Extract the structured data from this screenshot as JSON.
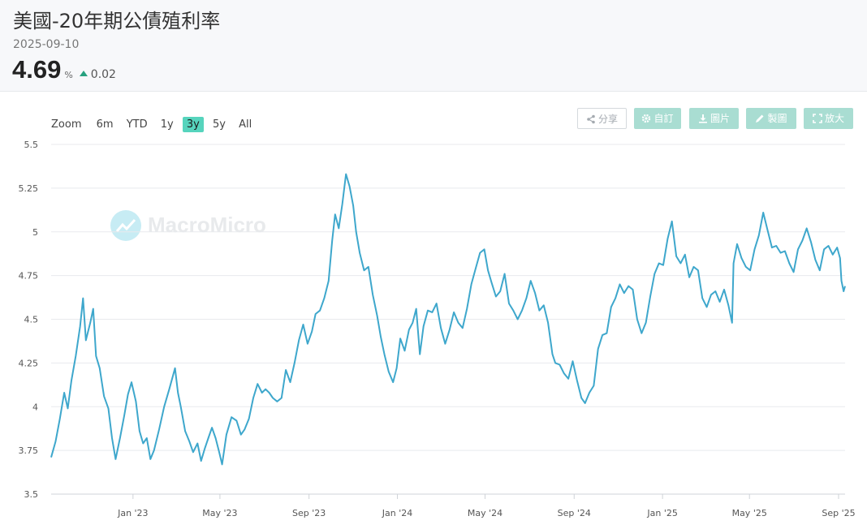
{
  "header": {
    "title": "美國-20年期公債殖利率",
    "date": "2025-09-10",
    "value": "4.69",
    "unit": "%",
    "change": "0.02"
  },
  "zoom": {
    "label": "Zoom",
    "options": [
      "6m",
      "YTD",
      "1y",
      "3y",
      "5y",
      "All"
    ],
    "active": "3y"
  },
  "toolbar": {
    "share": "分享",
    "customize": "自訂",
    "image": "圖片",
    "draw": "製圖",
    "fullscreen": "放大"
  },
  "watermark": "MacroMicro",
  "colors": {
    "line": "#3ea7cc",
    "accent": "#56d4bd",
    "up": "#27a17f"
  },
  "chart_data": {
    "type": "line",
    "title": "",
    "xlabel": "",
    "ylabel": "",
    "x_range": [
      "2022-09-10",
      "2025-09-10"
    ],
    "ylim": [
      3.5,
      5.5
    ],
    "y_ticks": [
      "3.5",
      "3.75",
      "4",
      "4.25",
      "4.5",
      "4.75",
      "5",
      "5.25",
      "5.5"
    ],
    "x_ticks": [
      {
        "date": "2023-01-01",
        "label": "Jan '23"
      },
      {
        "date": "2023-05-01",
        "label": "May '23"
      },
      {
        "date": "2023-09-01",
        "label": "Sep '23"
      },
      {
        "date": "2024-01-01",
        "label": "Jan '24"
      },
      {
        "date": "2024-05-01",
        "label": "May '24"
      },
      {
        "date": "2024-09-01",
        "label": "Sep '24"
      },
      {
        "date": "2025-01-01",
        "label": "Jan '25"
      },
      {
        "date": "2025-05-01",
        "label": "May '25"
      },
      {
        "date": "2025-09-01",
        "label": "Sep '25"
      }
    ],
    "grid": true,
    "legend": "none",
    "series": [
      {
        "points": [
          [
            "2022-09-10",
            3.71
          ],
          [
            "2022-09-16",
            3.8
          ],
          [
            "2022-09-22",
            3.93
          ],
          [
            "2022-09-28",
            4.08
          ],
          [
            "2022-10-03",
            3.99
          ],
          [
            "2022-10-08",
            4.15
          ],
          [
            "2022-10-14",
            4.29
          ],
          [
            "2022-10-20",
            4.46
          ],
          [
            "2022-10-24",
            4.62
          ],
          [
            "2022-10-28",
            4.38
          ],
          [
            "2022-11-03",
            4.48
          ],
          [
            "2022-11-07",
            4.56
          ],
          [
            "2022-11-11",
            4.29
          ],
          [
            "2022-11-16",
            4.22
          ],
          [
            "2022-11-22",
            4.06
          ],
          [
            "2022-11-28",
            3.99
          ],
          [
            "2022-12-03",
            3.82
          ],
          [
            "2022-12-08",
            3.7
          ],
          [
            "2022-12-14",
            3.82
          ],
          [
            "2022-12-20",
            3.95
          ],
          [
            "2022-12-25",
            4.07
          ],
          [
            "2022-12-30",
            4.14
          ],
          [
            "2023-01-05",
            4.03
          ],
          [
            "2023-01-10",
            3.86
          ],
          [
            "2023-01-15",
            3.79
          ],
          [
            "2023-01-20",
            3.82
          ],
          [
            "2023-01-25",
            3.7
          ],
          [
            "2023-01-30",
            3.75
          ],
          [
            "2023-02-06",
            3.87
          ],
          [
            "2023-02-13",
            4.0
          ],
          [
            "2023-02-20",
            4.1
          ],
          [
            "2023-02-28",
            4.22
          ],
          [
            "2023-03-04",
            4.08
          ],
          [
            "2023-03-08",
            4.0
          ],
          [
            "2023-03-14",
            3.86
          ],
          [
            "2023-03-20",
            3.8
          ],
          [
            "2023-03-25",
            3.74
          ],
          [
            "2023-03-31",
            3.79
          ],
          [
            "2023-04-05",
            3.69
          ],
          [
            "2023-04-10",
            3.76
          ],
          [
            "2023-04-15",
            3.82
          ],
          [
            "2023-04-20",
            3.88
          ],
          [
            "2023-04-25",
            3.82
          ],
          [
            "2023-04-30",
            3.74
          ],
          [
            "2023-05-04",
            3.67
          ],
          [
            "2023-05-10",
            3.84
          ],
          [
            "2023-05-17",
            3.94
          ],
          [
            "2023-05-24",
            3.92
          ],
          [
            "2023-05-30",
            3.84
          ],
          [
            "2023-06-04",
            3.87
          ],
          [
            "2023-06-10",
            3.93
          ],
          [
            "2023-06-16",
            4.05
          ],
          [
            "2023-06-22",
            4.13
          ],
          [
            "2023-06-28",
            4.08
          ],
          [
            "2023-07-03",
            4.1
          ],
          [
            "2023-07-08",
            4.08
          ],
          [
            "2023-07-13",
            4.05
          ],
          [
            "2023-07-19",
            4.03
          ],
          [
            "2023-07-25",
            4.05
          ],
          [
            "2023-07-31",
            4.21
          ],
          [
            "2023-08-06",
            4.14
          ],
          [
            "2023-08-12",
            4.25
          ],
          [
            "2023-08-18",
            4.38
          ],
          [
            "2023-08-24",
            4.47
          ],
          [
            "2023-08-30",
            4.36
          ],
          [
            "2023-09-05",
            4.43
          ],
          [
            "2023-09-10",
            4.53
          ],
          [
            "2023-09-16",
            4.55
          ],
          [
            "2023-09-22",
            4.62
          ],
          [
            "2023-09-28",
            4.72
          ],
          [
            "2023-10-03",
            4.95
          ],
          [
            "2023-10-07",
            5.1
          ],
          [
            "2023-10-12",
            5.02
          ],
          [
            "2023-10-17",
            5.16
          ],
          [
            "2023-10-22",
            5.33
          ],
          [
            "2023-10-27",
            5.26
          ],
          [
            "2023-11-01",
            5.15
          ],
          [
            "2023-11-05",
            5.0
          ],
          [
            "2023-11-10",
            4.88
          ],
          [
            "2023-11-16",
            4.78
          ],
          [
            "2023-11-22",
            4.8
          ],
          [
            "2023-11-28",
            4.64
          ],
          [
            "2023-12-04",
            4.52
          ],
          [
            "2023-12-09",
            4.4
          ],
          [
            "2023-12-14",
            4.3
          ],
          [
            "2023-12-20",
            4.2
          ],
          [
            "2023-12-26",
            4.14
          ],
          [
            "2023-12-31",
            4.22
          ],
          [
            "2024-01-05",
            4.39
          ],
          [
            "2024-01-11",
            4.32
          ],
          [
            "2024-01-17",
            4.44
          ],
          [
            "2024-01-22",
            4.48
          ],
          [
            "2024-01-27",
            4.56
          ],
          [
            "2024-02-01",
            4.3
          ],
          [
            "2024-02-06",
            4.46
          ],
          [
            "2024-02-12",
            4.55
          ],
          [
            "2024-02-18",
            4.54
          ],
          [
            "2024-02-24",
            4.59
          ],
          [
            "2024-03-01",
            4.45
          ],
          [
            "2024-03-07",
            4.36
          ],
          [
            "2024-03-13",
            4.44
          ],
          [
            "2024-03-19",
            4.54
          ],
          [
            "2024-03-25",
            4.48
          ],
          [
            "2024-03-31",
            4.45
          ],
          [
            "2024-04-06",
            4.56
          ],
          [
            "2024-04-12",
            4.7
          ],
          [
            "2024-04-18",
            4.79
          ],
          [
            "2024-04-24",
            4.88
          ],
          [
            "2024-04-30",
            4.9
          ],
          [
            "2024-05-05",
            4.78
          ],
          [
            "2024-05-10",
            4.71
          ],
          [
            "2024-05-16",
            4.63
          ],
          [
            "2024-05-22",
            4.66
          ],
          [
            "2024-05-28",
            4.76
          ],
          [
            "2024-06-03",
            4.59
          ],
          [
            "2024-06-09",
            4.55
          ],
          [
            "2024-06-15",
            4.5
          ],
          [
            "2024-06-21",
            4.55
          ],
          [
            "2024-06-27",
            4.62
          ],
          [
            "2024-07-03",
            4.72
          ],
          [
            "2024-07-09",
            4.65
          ],
          [
            "2024-07-15",
            4.55
          ],
          [
            "2024-07-21",
            4.58
          ],
          [
            "2024-07-27",
            4.48
          ],
          [
            "2024-08-02",
            4.3
          ],
          [
            "2024-08-06",
            4.25
          ],
          [
            "2024-08-12",
            4.24
          ],
          [
            "2024-08-18",
            4.19
          ],
          [
            "2024-08-24",
            4.16
          ],
          [
            "2024-08-30",
            4.26
          ],
          [
            "2024-09-05",
            4.15
          ],
          [
            "2024-09-11",
            4.05
          ],
          [
            "2024-09-16",
            4.02
          ],
          [
            "2024-09-22",
            4.08
          ],
          [
            "2024-09-28",
            4.12
          ],
          [
            "2024-10-04",
            4.33
          ],
          [
            "2024-10-10",
            4.41
          ],
          [
            "2024-10-16",
            4.42
          ],
          [
            "2024-10-22",
            4.57
          ],
          [
            "2024-10-28",
            4.62
          ],
          [
            "2024-11-03",
            4.7
          ],
          [
            "2024-11-09",
            4.65
          ],
          [
            "2024-11-15",
            4.69
          ],
          [
            "2024-11-21",
            4.67
          ],
          [
            "2024-11-27",
            4.5
          ],
          [
            "2024-12-03",
            4.42
          ],
          [
            "2024-12-09",
            4.48
          ],
          [
            "2024-12-15",
            4.63
          ],
          [
            "2024-12-21",
            4.76
          ],
          [
            "2024-12-27",
            4.82
          ],
          [
            "2025-01-02",
            4.81
          ],
          [
            "2025-01-08",
            4.96
          ],
          [
            "2025-01-14",
            5.06
          ],
          [
            "2025-01-20",
            4.86
          ],
          [
            "2025-01-26",
            4.82
          ],
          [
            "2025-02-01",
            4.87
          ],
          [
            "2025-02-07",
            4.74
          ],
          [
            "2025-02-13",
            4.8
          ],
          [
            "2025-02-19",
            4.78
          ],
          [
            "2025-02-25",
            4.62
          ],
          [
            "2025-03-03",
            4.57
          ],
          [
            "2025-03-09",
            4.64
          ],
          [
            "2025-03-15",
            4.66
          ],
          [
            "2025-03-21",
            4.6
          ],
          [
            "2025-03-27",
            4.67
          ],
          [
            "2025-04-02",
            4.58
          ],
          [
            "2025-04-07",
            4.48
          ],
          [
            "2025-04-09",
            4.82
          ],
          [
            "2025-04-14",
            4.93
          ],
          [
            "2025-04-20",
            4.85
          ],
          [
            "2025-04-26",
            4.8
          ],
          [
            "2025-05-02",
            4.78
          ],
          [
            "2025-05-08",
            4.9
          ],
          [
            "2025-05-14",
            4.98
          ],
          [
            "2025-05-20",
            5.11
          ],
          [
            "2025-05-26",
            5.01
          ],
          [
            "2025-06-01",
            4.91
          ],
          [
            "2025-06-07",
            4.92
          ],
          [
            "2025-06-13",
            4.88
          ],
          [
            "2025-06-19",
            4.89
          ],
          [
            "2025-06-25",
            4.82
          ],
          [
            "2025-07-01",
            4.77
          ],
          [
            "2025-07-07",
            4.9
          ],
          [
            "2025-07-13",
            4.95
          ],
          [
            "2025-07-19",
            5.02
          ],
          [
            "2025-07-25",
            4.94
          ],
          [
            "2025-07-31",
            4.84
          ],
          [
            "2025-08-06",
            4.78
          ],
          [
            "2025-08-12",
            4.9
          ],
          [
            "2025-08-18",
            4.92
          ],
          [
            "2025-08-24",
            4.87
          ],
          [
            "2025-08-30",
            4.91
          ],
          [
            "2025-09-03",
            4.85
          ],
          [
            "2025-09-05",
            4.72
          ],
          [
            "2025-09-08",
            4.66
          ],
          [
            "2025-09-10",
            4.69
          ]
        ]
      }
    ]
  }
}
